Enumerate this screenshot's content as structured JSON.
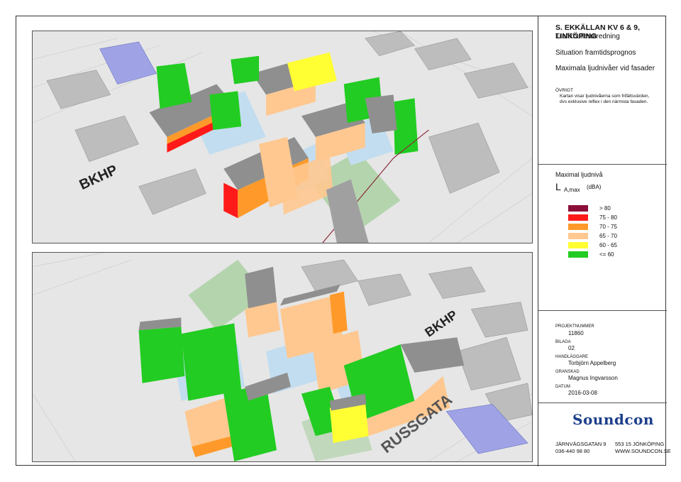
{
  "title": {
    "main": "S. EKKÄLLAN KV 6 & 9, LINKÖPING",
    "line2": "Trafikbullerutredning",
    "line3": "Situation framtidsprognos",
    "line4": "Maximala ljudnivåer vid fasader"
  },
  "note": {
    "heading": "ÖVRIGT",
    "line1": "Kartan visar ljudnivåerna som frifältsvärden,",
    "line2": "dvs exklusive reflex i den närmsta fasaden."
  },
  "legend": {
    "title": "Maximal ljudnivå",
    "symbol": "L",
    "subscript": "A,max",
    "unit": "(dBA)",
    "items": [
      {
        "label": ">  80",
        "color": "#8b0e3a"
      },
      {
        "label": "75 -  80",
        "color": "#ff1a1a"
      },
      {
        "label": "70 -  75",
        "color": "#ff9a2a"
      },
      {
        "label": "65 -  70",
        "color": "#ffc890"
      },
      {
        "label": "60 -  65",
        "color": "#ffff33"
      },
      {
        "label": "<= 60",
        "color": "#22cc22"
      }
    ]
  },
  "info": {
    "projekt_label": "PROJEKTNUMMER",
    "projekt_value": "11860",
    "bilaga_label": "BILAGA",
    "bilaga_value": "02",
    "handlaggare_label": "HANDLÄGGARE",
    "handlaggare_value": "Torbjörn Appelberg",
    "granskad_label": "GRANSKAD",
    "granskad_value": "Magnus Ingvarsson",
    "datum_label": "DATUM",
    "datum_value": "2016-03-08"
  },
  "company": {
    "logo": "Soundcon",
    "street": "JÄRNVÄGSGATAN 9",
    "phone": "036-440 98 80",
    "city": "553 15 JÖNKÖPING",
    "web": "WWW.SOUNDCON.SE"
  },
  "map_labels": {
    "bkhp_top": "BKHP",
    "bkhp_bottom": "BKHP",
    "street_bottom": "RUSSGATA"
  }
}
